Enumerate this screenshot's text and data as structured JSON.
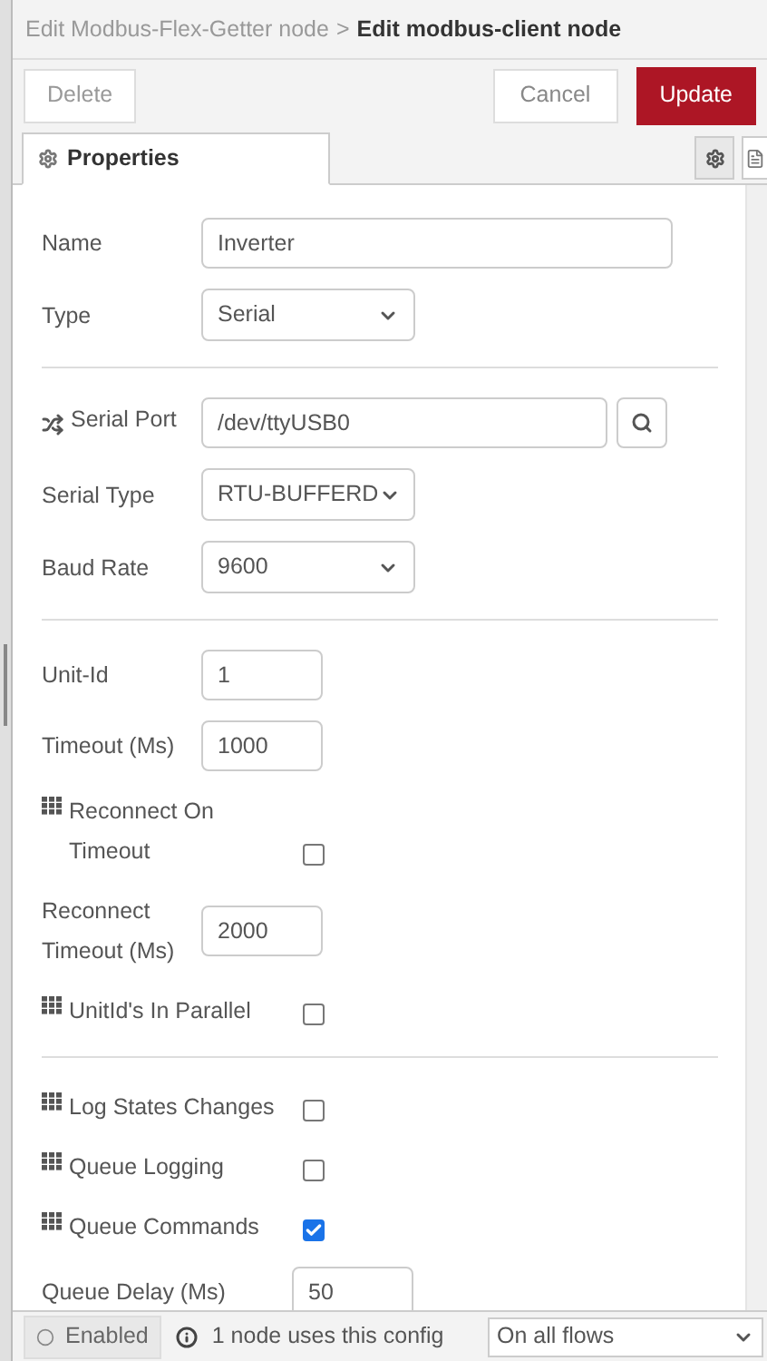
{
  "breadcrumb": {
    "parent": "Edit Modbus-Flex-Getter node",
    "separator": ">",
    "current": "Edit modbus-client node"
  },
  "toolbar": {
    "delete": "Delete",
    "cancel": "Cancel",
    "update": "Update"
  },
  "tabs": [
    {
      "label": "Properties",
      "selected": true
    }
  ],
  "sections": [
    {
      "rows": [
        {
          "kind": "text",
          "label": "Name",
          "value": "Inverter"
        },
        {
          "kind": "select",
          "label": "Type",
          "value": "Serial"
        }
      ]
    },
    {
      "rows": [
        {
          "kind": "port",
          "label": "Serial Port",
          "value": "/dev/ttyUSB0"
        },
        {
          "kind": "select",
          "label": "Serial Type",
          "value": "RTU-BUFFERD"
        },
        {
          "kind": "select",
          "label": "Baud Rate",
          "value": "9600"
        }
      ]
    },
    {
      "rows": [
        {
          "kind": "number",
          "label": "Unit-Id",
          "value": "1"
        },
        {
          "kind": "number",
          "label": "Timeout (Ms)",
          "value": "1000"
        },
        {
          "kind": "checkbox",
          "label": "Reconnect On Timeout",
          "checked": false
        },
        {
          "kind": "number",
          "label": "Reconnect Timeout (Ms)",
          "value": "2000"
        },
        {
          "kind": "checkbox",
          "label": "UnitId's In Parallel",
          "checked": false
        }
      ]
    },
    {
      "rows": [
        {
          "kind": "checkbox",
          "label": "Log States Changes",
          "checked": false
        },
        {
          "kind": "checkbox",
          "label": "Queue Logging",
          "checked": false
        },
        {
          "kind": "checkbox",
          "label": "Queue Commands",
          "checked": true
        },
        {
          "kind": "wide_number",
          "label": "Queue Delay (Ms)",
          "value": "50"
        }
      ]
    }
  ],
  "footer": {
    "enabled": "Enabled",
    "usage": "1 node uses this config",
    "scope": "On all flows"
  }
}
